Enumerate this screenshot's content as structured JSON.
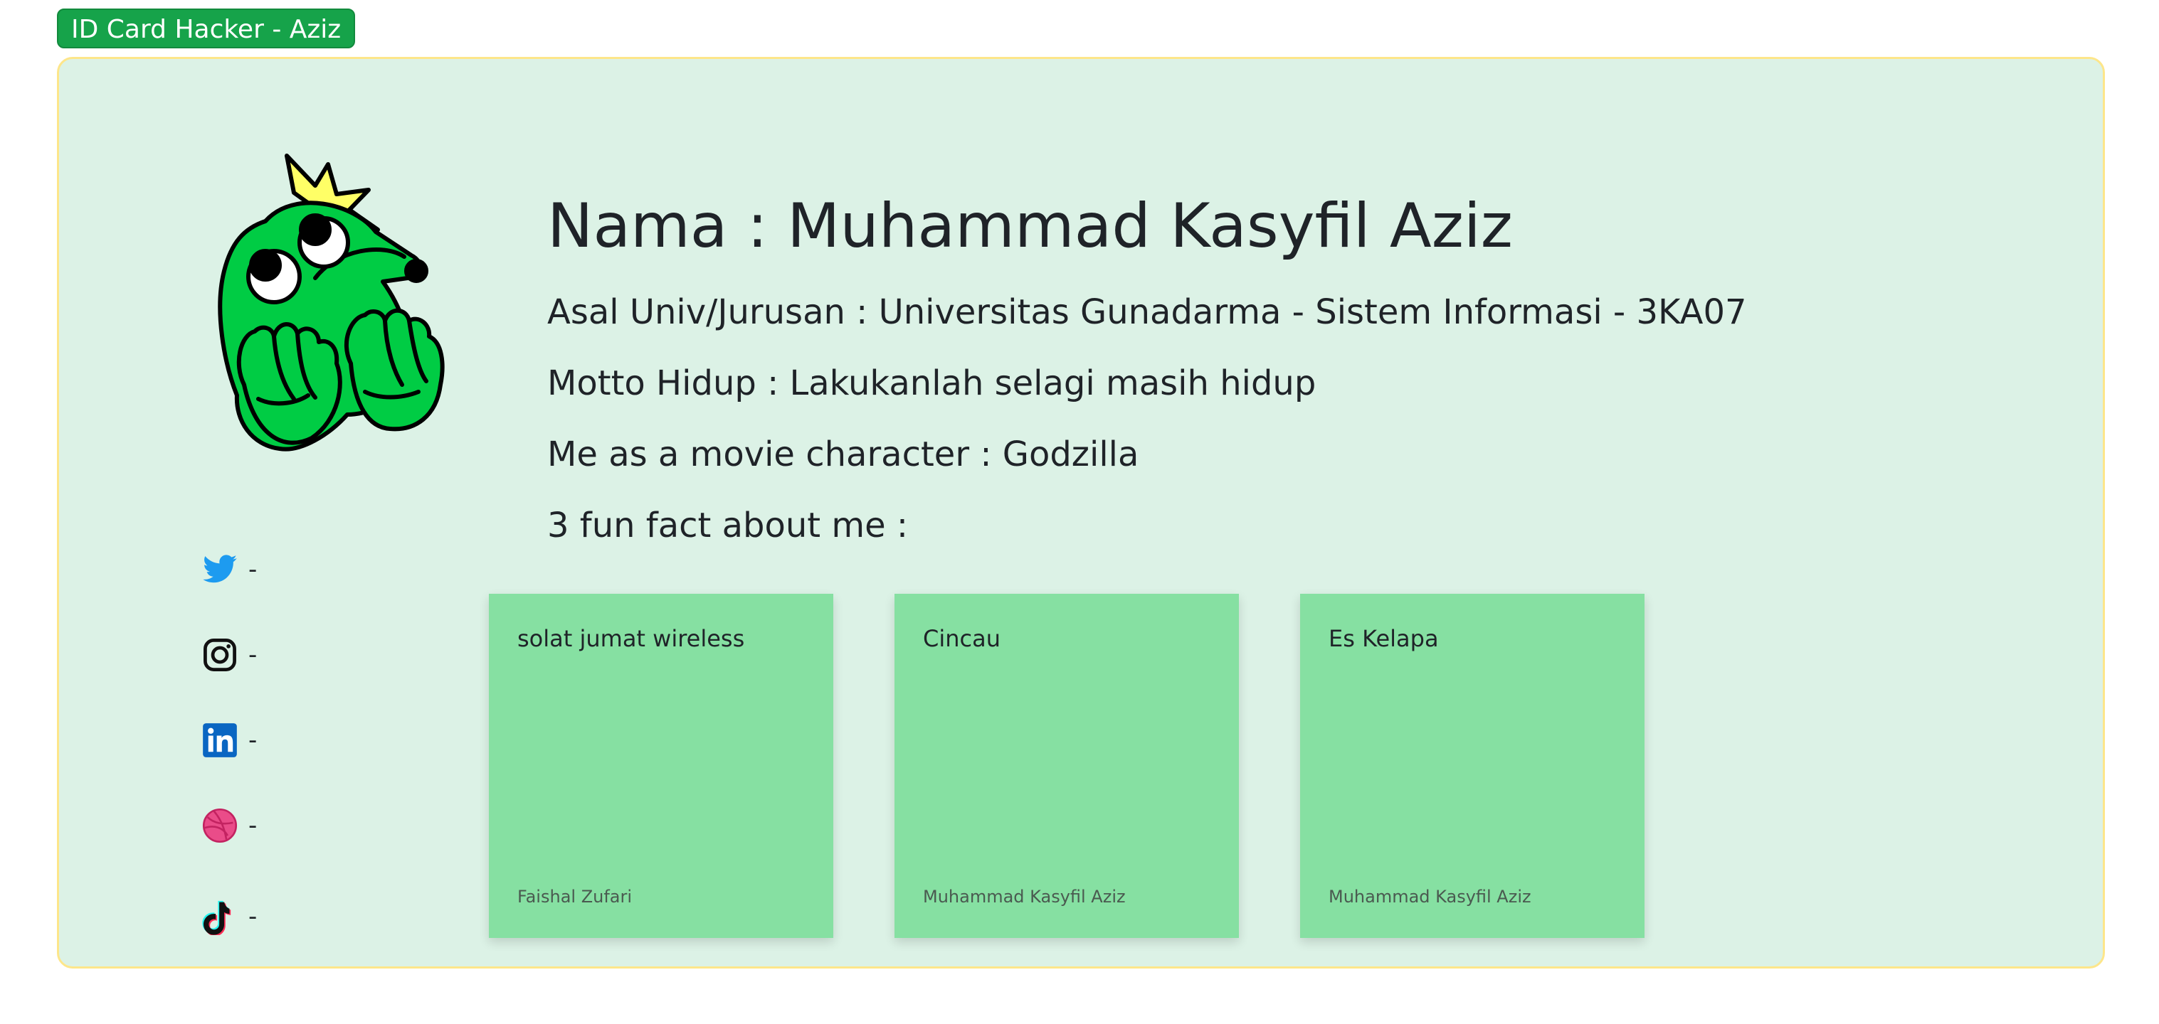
{
  "header": {
    "badge_label": "ID Card Hacker - Aziz"
  },
  "profile": {
    "name_line": "Nama : Muhammad Kasyfil Aziz",
    "univ_line": "Asal Univ/Jurusan : Universitas Gunadarma - Sistem Informasi - 3KA07",
    "motto_line": "Motto Hidup : Lakukanlah selagi masih hidup",
    "movie_line": "Me as a movie character : Godzilla",
    "facts_heading": "3 fun fact about me :"
  },
  "socials": [
    {
      "icon": "twitter-icon",
      "value": "-",
      "color": "#1d9bf0"
    },
    {
      "icon": "instagram-icon",
      "value": "-",
      "color": "#111111"
    },
    {
      "icon": "linkedin-icon",
      "value": "-",
      "color": "#0a66c2"
    },
    {
      "icon": "dribbble-icon",
      "value": "-",
      "color": "#ea4c89"
    },
    {
      "icon": "tiktok-icon",
      "value": "-",
      "color": "#111111"
    }
  ],
  "facts": [
    {
      "text": "solat jumat wireless",
      "author": "Faishal Zufari"
    },
    {
      "text": "Cincau",
      "author": "Muhammad Kasyfil Aziz"
    },
    {
      "text": "Es Kelapa",
      "author": "Muhammad Kasyfil Aziz"
    }
  ],
  "colors": {
    "badge_bg": "#16a34a",
    "card_bg": "#dcf2e6",
    "card_border": "#fde68a",
    "fact_bg": "#86e0a2",
    "mascot_green": "#00cc44",
    "crown_yellow": "#ffff66"
  }
}
